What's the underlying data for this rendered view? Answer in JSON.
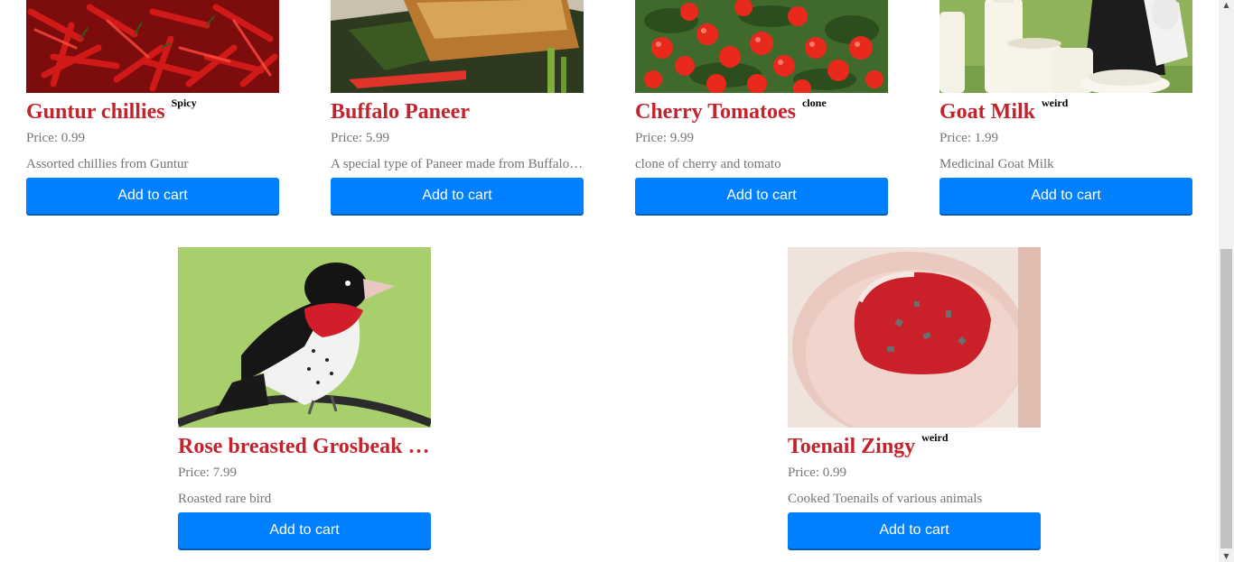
{
  "products": [
    {
      "title": "Guntur chillies",
      "tag": "Spicy",
      "price": "Price: 0.99",
      "description": "Assorted chillies from Guntur",
      "button": "Add to cart",
      "image": "red-chillies-photo"
    },
    {
      "title": "Buffalo Paneer",
      "tag": "",
      "price": "Price: 5.99",
      "description": "A special type of Paneer made from Buffalo milk",
      "button": "Add to cart",
      "image": "grilled-paneer-photo"
    },
    {
      "title": "Cherry Tomatoes",
      "tag": "clone",
      "price": "Price: 9.99",
      "description": "clone of cherry and tomato",
      "button": "Add to cart",
      "image": "cherry-tomatoes-photo"
    },
    {
      "title": "Goat Milk",
      "tag": "weird",
      "price": "Price: 1.99",
      "description": "Medicinal Goat Milk",
      "button": "Add to cart",
      "image": "goat-milk-photo"
    },
    {
      "title": "Rose breasted Grosbeak Roast",
      "tag": "",
      "price": "Price: 7.99",
      "description": "Roasted rare bird",
      "button": "Add to cart",
      "image": "grosbeak-bird-photo"
    },
    {
      "title": "Toenail Zingy",
      "tag": "weird",
      "price": "Price: 0.99",
      "description": "Cooked Toenails of various animals",
      "button": "Add to cart",
      "image": "painted-toenail-photo"
    }
  ],
  "colors": {
    "title": "#c3232d",
    "button": "#0080ff",
    "muted_text": "#757575"
  }
}
